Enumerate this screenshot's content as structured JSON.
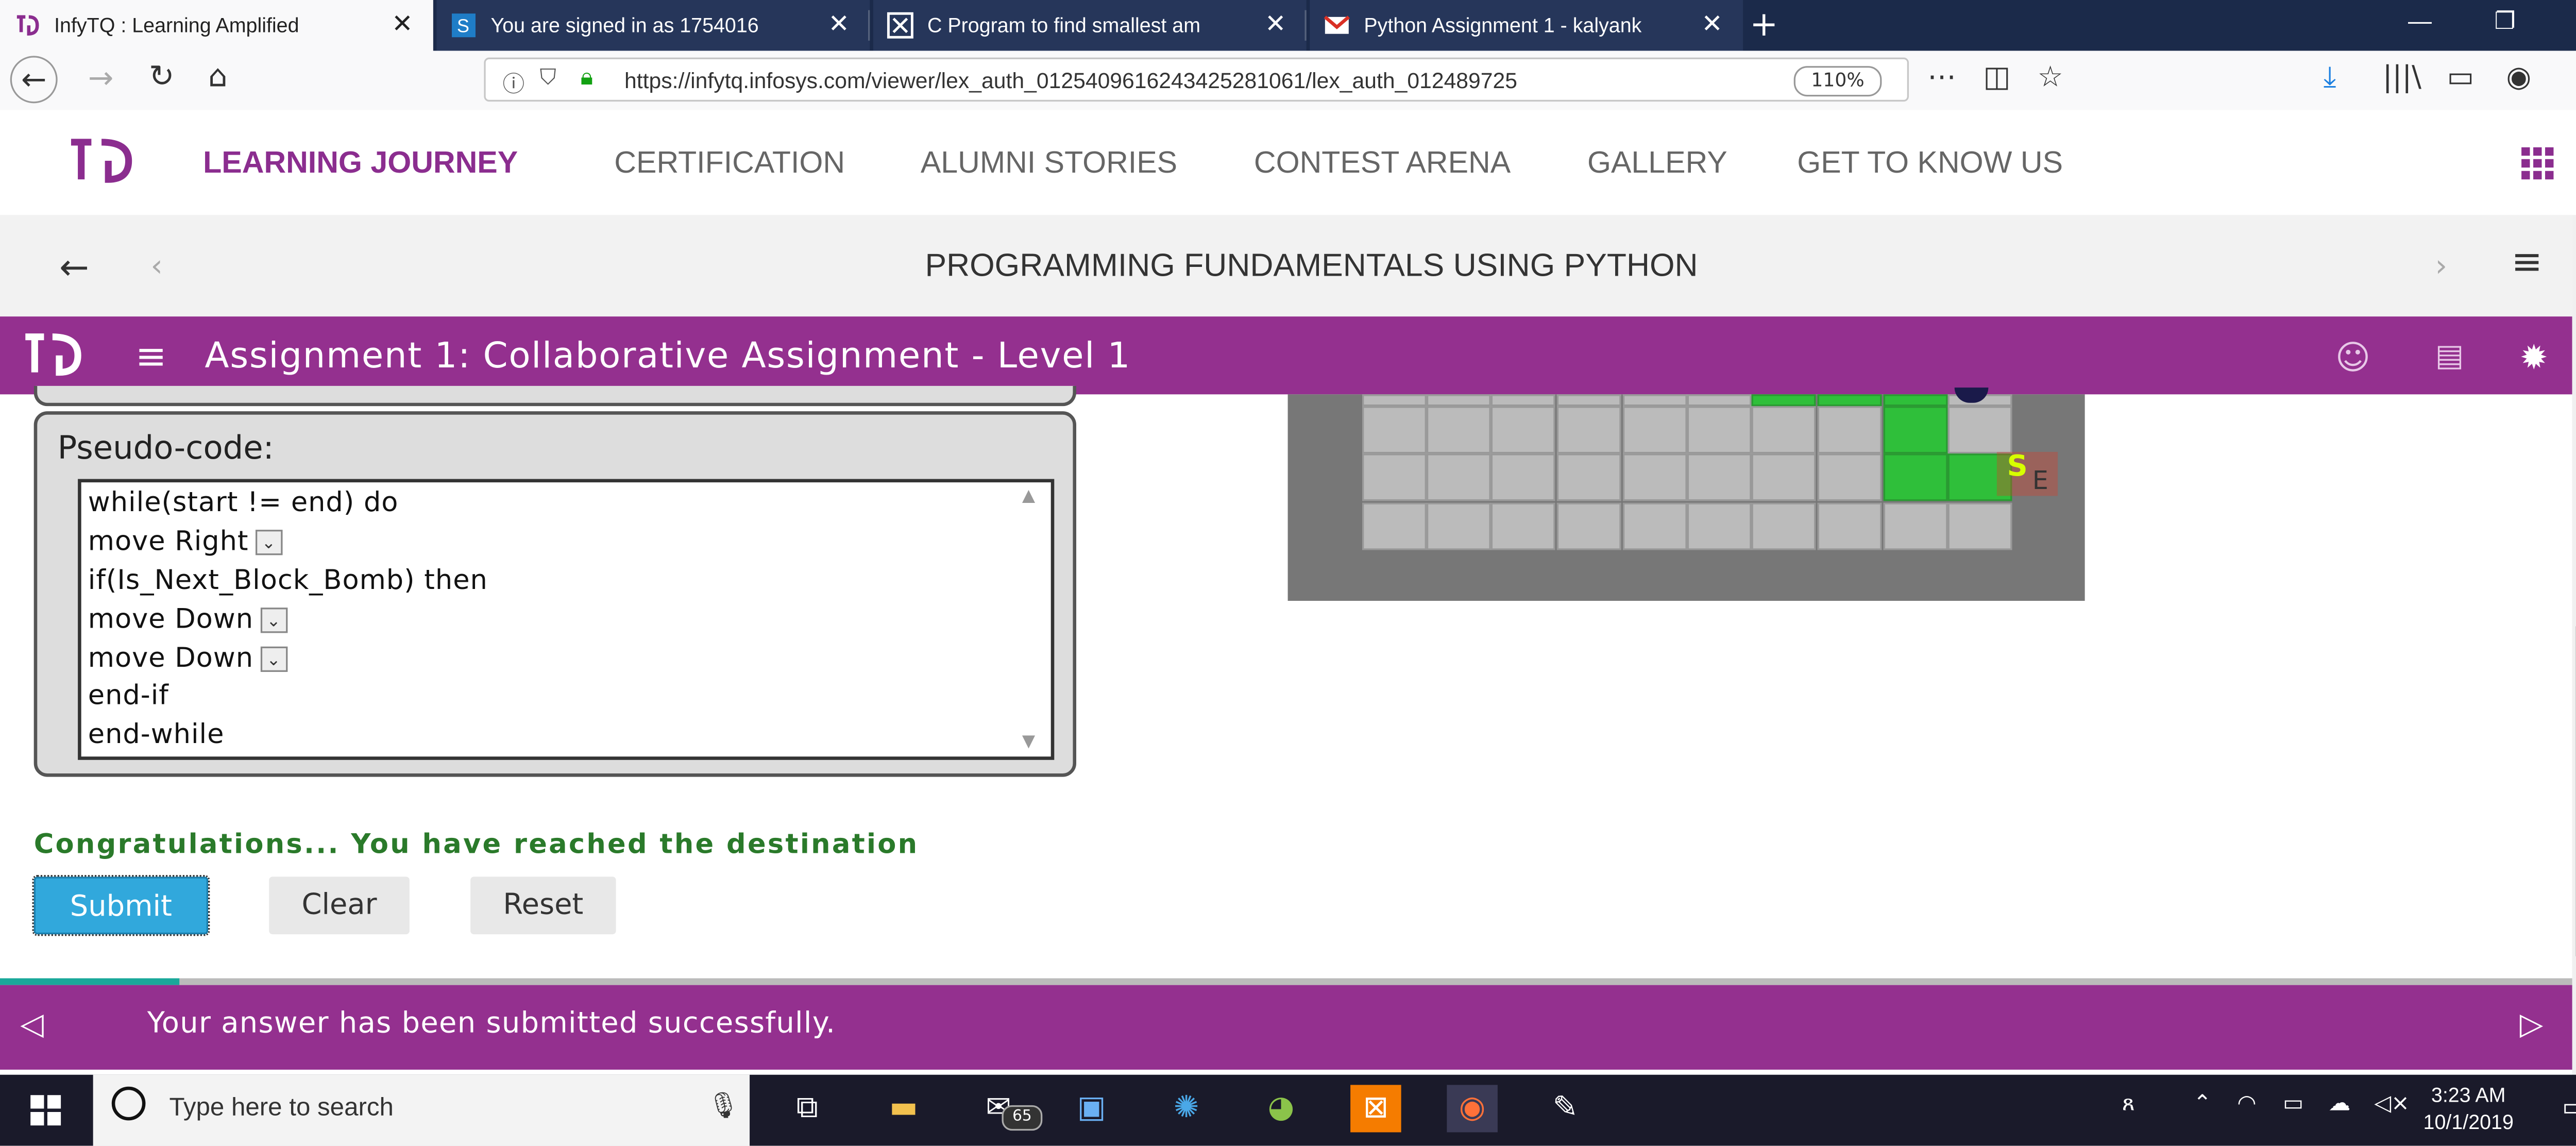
{
  "browser": {
    "tabs": [
      {
        "label": "InfyTQ : Learning Amplified",
        "icon": "infytq-tab-icon"
      },
      {
        "label": "You are signed in as 1754016",
        "icon": "signin-tab-icon"
      },
      {
        "label": "C Program to find smallest am",
        "icon": "c-program-tab-icon"
      },
      {
        "label": "Python Assignment 1 - kalyank",
        "icon": "gmail-tab-icon"
      }
    ],
    "url": "https://infytq.infosys.com/viewer/lex_auth_0125409616243425281061/lex_auth_012489725",
    "zoom": "110%"
  },
  "site": {
    "nav": [
      "LEARNING JOURNEY",
      "CERTIFICATION",
      "ALUMNI STORIES",
      "CONTEST ARENA",
      "GALLERY",
      "GET TO KNOW US"
    ]
  },
  "course": {
    "title": "PROGRAMMING FUNDAMENTALS USING PYTHON"
  },
  "assignment": {
    "title": "Assignment 1: Collaborative Assignment - Level 1",
    "pseudo_label": "Pseudo-code:",
    "code": [
      {
        "text": "while(start != end) do",
        "dropdown": false
      },
      {
        "text": "move  Right",
        "dropdown": true
      },
      {
        "text": "if(Is_Next_Block_Bomb) then",
        "dropdown": false
      },
      {
        "text": "move  Down",
        "dropdown": true
      },
      {
        "text": "move  Down",
        "dropdown": true
      },
      {
        "text": "end-if",
        "dropdown": false
      },
      {
        "text": "end-while",
        "dropdown": false
      }
    ],
    "marker_start": "S",
    "marker_end": "E",
    "congrats": "Congratulations... You have reached the destination",
    "buttons": {
      "submit": "Submit",
      "clear": "Clear",
      "reset": "Reset"
    },
    "notice": "Your answer has been submitted successfully."
  },
  "taskbar": {
    "search_placeholder": "Type here to search",
    "mail_badge": "65",
    "time": "3:23 AM",
    "date": "10/1/2019"
  },
  "colors": {
    "brand_purple": "#94308f",
    "submit_blue": "#31a8dc",
    "path_green": "#2fbf3a",
    "success_green": "#2a7a2a"
  }
}
